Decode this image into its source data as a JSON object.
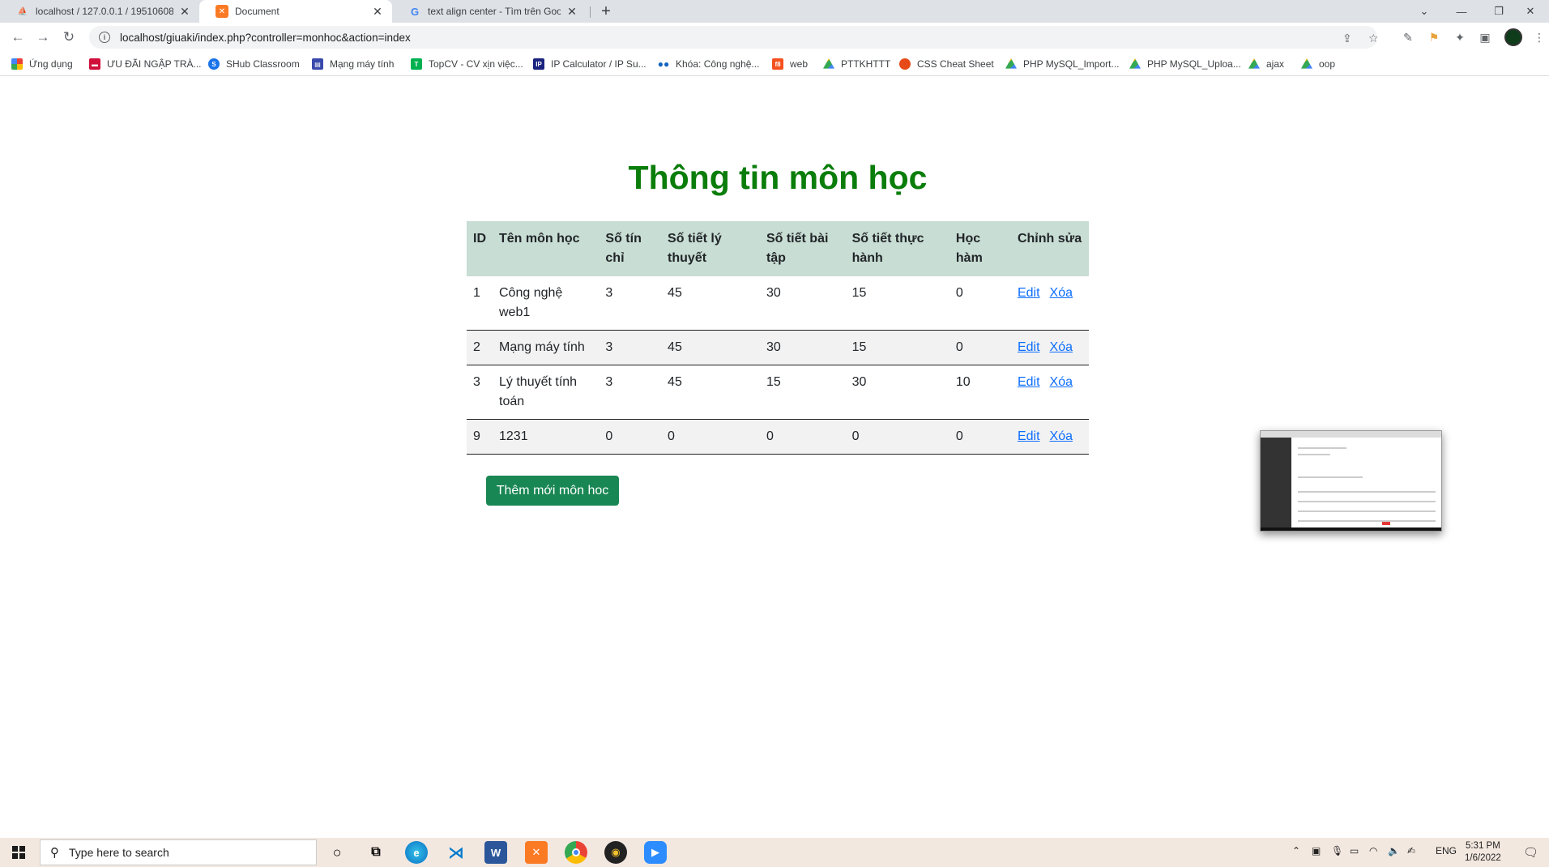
{
  "browser": {
    "tabs": [
      {
        "title": "localhost / 127.0.0.1 / 19510608",
        "favicon": "phpmyadmin-icon",
        "active": false
      },
      {
        "title": "Document",
        "favicon": "xampp-icon",
        "active": true
      },
      {
        "title": "text align center - Tìm trên Goog",
        "favicon": "google-icon",
        "active": false
      }
    ],
    "new_tab": "+",
    "url": "localhost/giuaki/index.php?controller=monhoc&action=index",
    "bookmarks": [
      {
        "label": "Ứng dụng",
        "icon": "apps-grid-icon",
        "color": "#ea4335"
      },
      {
        "label": "ƯU ĐÃI NGẬP TRÀ...",
        "icon": "bookmark-red-icon",
        "color": "#d0103a"
      },
      {
        "label": "SHub Classroom",
        "icon": "shub-icon",
        "color": "#1a73e8"
      },
      {
        "label": "Mạng máy tính",
        "icon": "doc-icon",
        "color": "#3949ab"
      },
      {
        "label": "TopCV - CV xịn việc...",
        "icon": "topcv-icon",
        "color": "#00b14f"
      },
      {
        "label": "IP Calculator / IP Su...",
        "icon": "ip-icon",
        "color": "#1a237e"
      },
      {
        "label": "Khóa: Công nghệ...",
        "icon": "dots-icon",
        "color": "#1565c0"
      },
      {
        "label": "web",
        "icon": "f8-icon",
        "color": "#f4511e"
      },
      {
        "label": "PTTKHTTT",
        "icon": "drive-icon",
        "color": "#34a853"
      },
      {
        "label": "CSS Cheat Sheet",
        "icon": "css-icon",
        "color": "#e64a19"
      },
      {
        "label": "PHP MySQL_Import...",
        "icon": "drive-icon",
        "color": "#34a853"
      },
      {
        "label": "PHP MySQL_Uploa...",
        "icon": "drive-icon",
        "color": "#34a853"
      },
      {
        "label": "ajax",
        "icon": "drive-icon",
        "color": "#34a853"
      },
      {
        "label": "oop",
        "icon": "drive-icon",
        "color": "#34a853"
      }
    ]
  },
  "page": {
    "title": "Thông tin môn học",
    "columns": [
      "ID",
      "Tên môn học",
      "Số tín chỉ",
      "Số tiết lý thuyết",
      "Số tiết bài tập",
      "Số tiết thực hành",
      "Học hàm",
      "Chỉnh sửa"
    ],
    "rows": [
      {
        "id": "1",
        "name": "Công nghệ web1",
        "credits": "3",
        "theory": "45",
        "exercise": "30",
        "practice": "15",
        "rank": "0",
        "edit": "Edit",
        "delete": "Xóa"
      },
      {
        "id": "2",
        "name": "Mạng máy tính",
        "credits": "3",
        "theory": "45",
        "exercise": "30",
        "practice": "15",
        "rank": "0",
        "edit": "Edit",
        "delete": "Xóa"
      },
      {
        "id": "3",
        "name": "Lý thuyết tính toán",
        "credits": "3",
        "theory": "45",
        "exercise": "15",
        "practice": "30",
        "rank": "10",
        "edit": "Edit",
        "delete": "Xóa"
      },
      {
        "id": "9",
        "name": "1231",
        "credits": "0",
        "theory": "0",
        "exercise": "0",
        "practice": "0",
        "rank": "0",
        "edit": "Edit",
        "delete": "Xóa"
      }
    ],
    "add_button": "Thêm mới môn hoc"
  },
  "taskbar": {
    "search_placeholder": "Type here to search",
    "lang": "ENG",
    "time": "5:31 PM",
    "date": "1/6/2022"
  }
}
